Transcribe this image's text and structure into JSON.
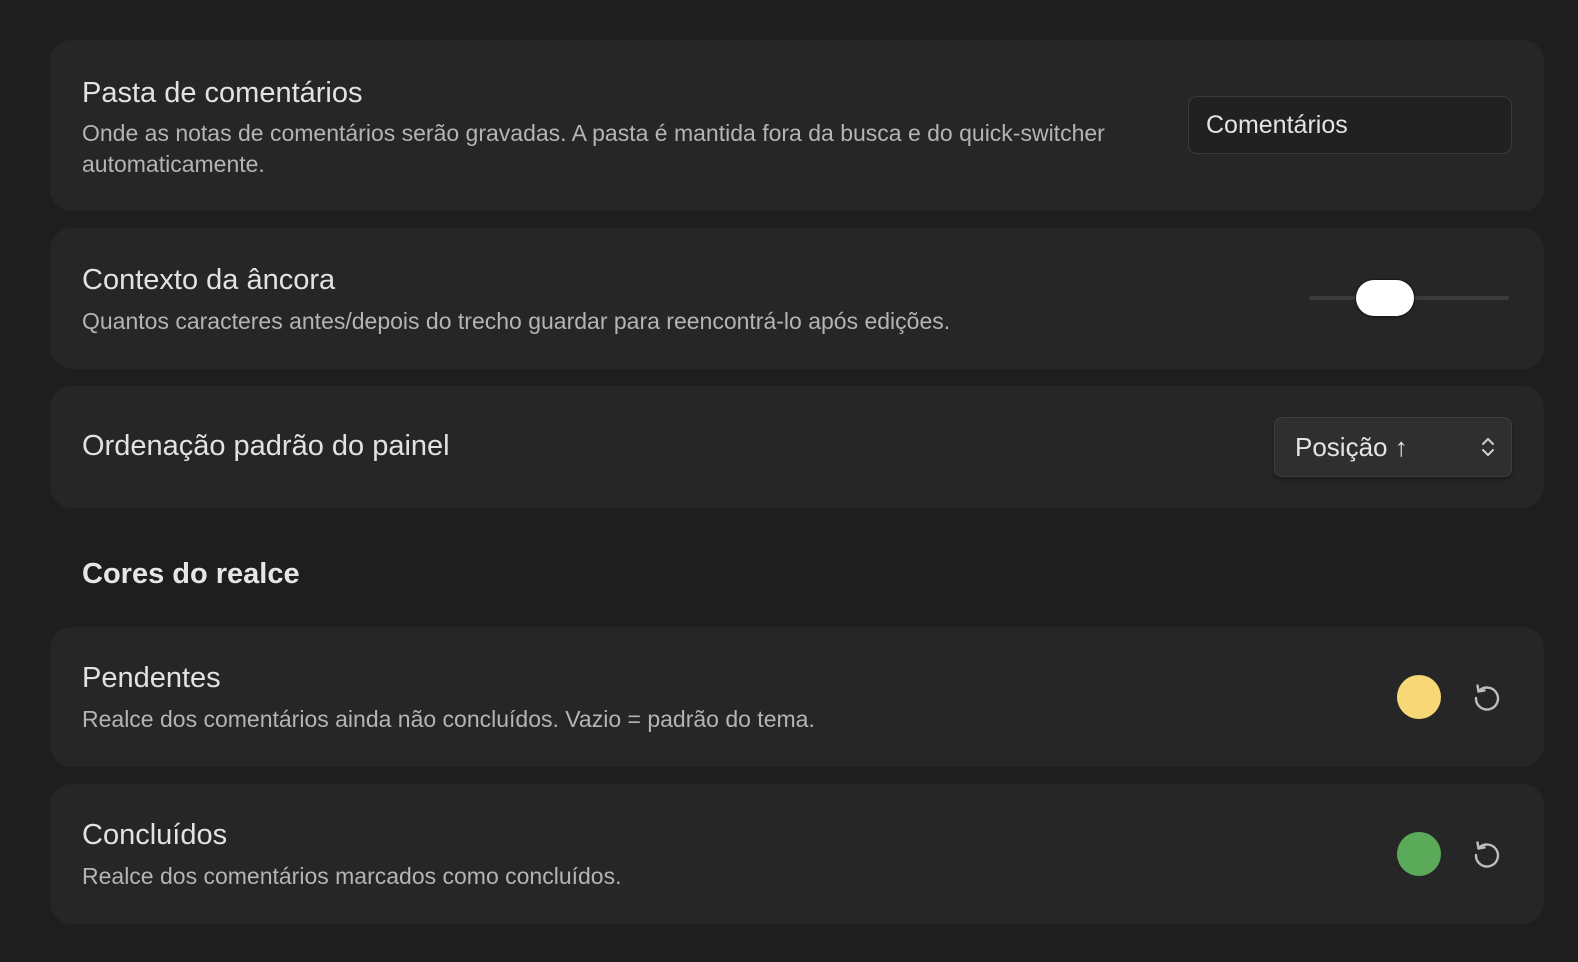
{
  "settings": {
    "comments_folder": {
      "title": "Pasta de comentários",
      "description": "Onde as notas de comentários serão gravadas. A pasta é mantida fora da busca e do quick-switcher automaticamente.",
      "value": "Comentários"
    },
    "anchor_context": {
      "title": "Contexto da âncora",
      "description": "Quantos caracteres antes/depois do trecho guardar para reencontrá-lo após edições."
    },
    "default_sort": {
      "title": "Ordenação padrão do painel",
      "selected": "Posição ↑"
    }
  },
  "highlight_colors": {
    "heading": "Cores do realce",
    "pending": {
      "title": "Pendentes",
      "description": "Realce dos comentários ainda não concluídos. Vazio = padrão do tema.",
      "color": "#f8d777"
    },
    "done": {
      "title": "Concluídos",
      "description": "Realce dos comentários marcados como concluídos.",
      "color": "#5aaa5a"
    }
  },
  "icons": {
    "reset": "reset-icon",
    "select_chevron": "chevron-up-down-icon"
  }
}
